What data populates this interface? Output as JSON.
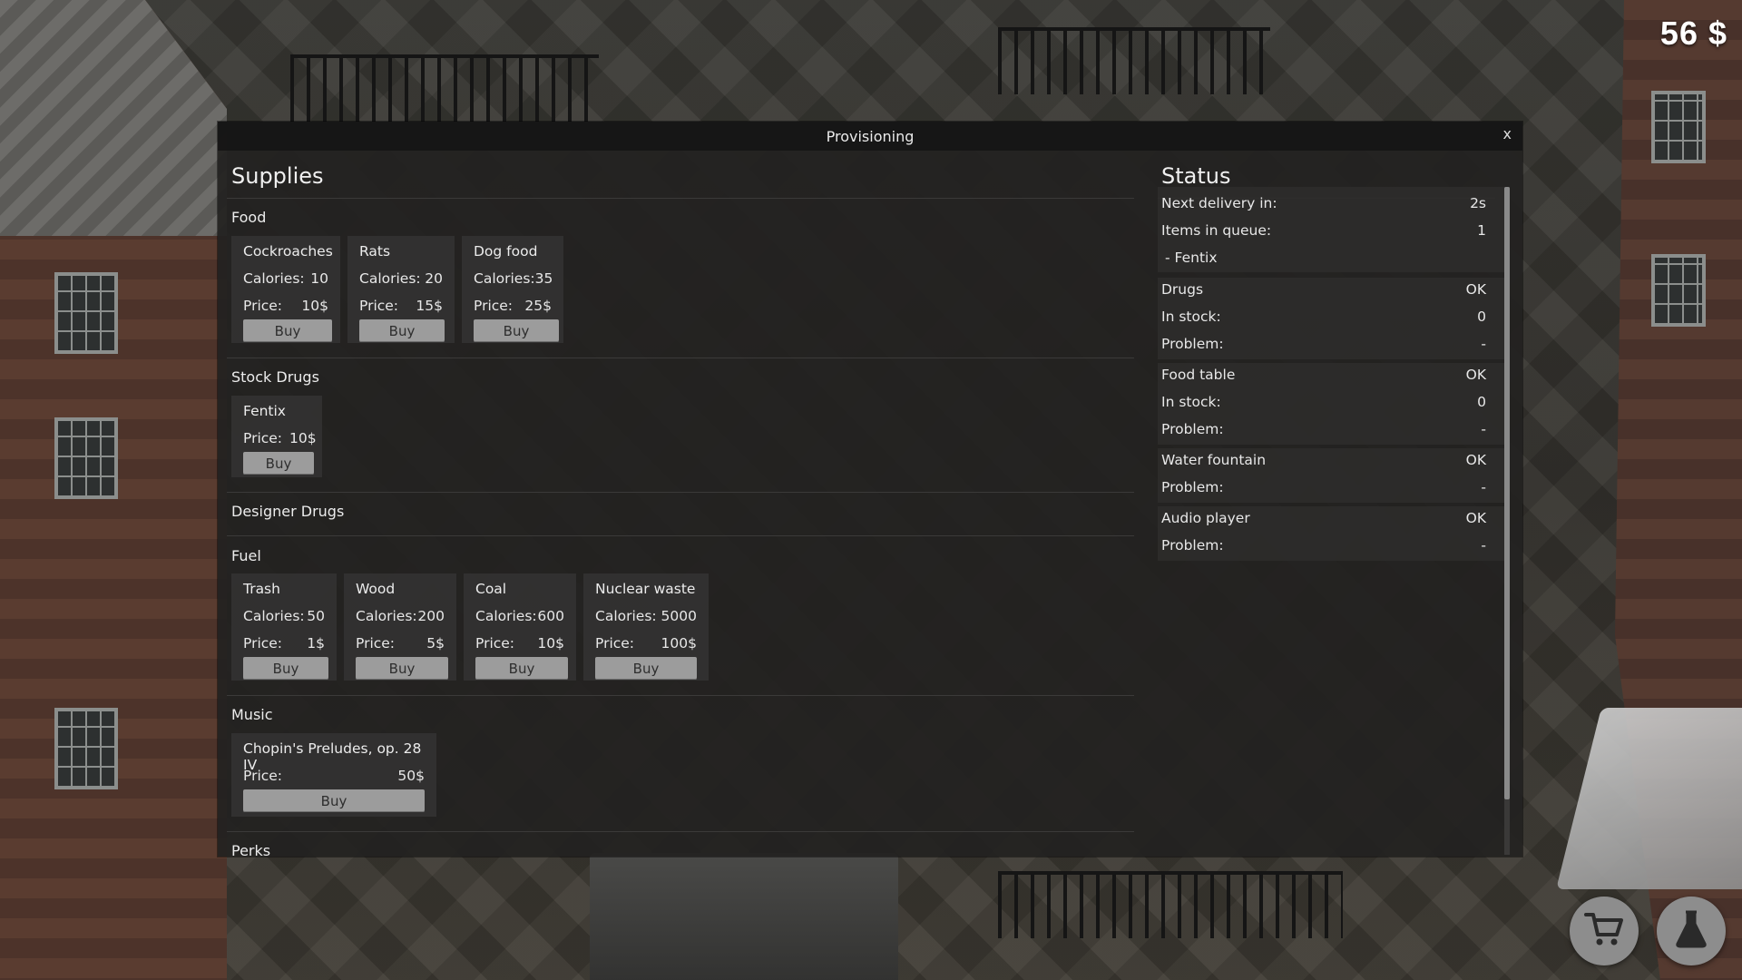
{
  "hud": {
    "money": "56 $"
  },
  "window": {
    "title": "Provisioning",
    "close": "x"
  },
  "supplies": {
    "heading": "Supplies",
    "categories": [
      {
        "name": "Food",
        "items": [
          {
            "name": "Cockroaches",
            "calories_label": "Calories:",
            "calories": "10",
            "price_label": "Price:",
            "price": "10$",
            "buy": "Buy"
          },
          {
            "name": "Rats",
            "calories_label": "Calories:",
            "calories": "20",
            "price_label": "Price:",
            "price": "15$",
            "buy": "Buy"
          },
          {
            "name": "Dog food",
            "calories_label": "Calories:",
            "calories": "35",
            "price_label": "Price:",
            "price": "25$",
            "buy": "Buy"
          }
        ]
      },
      {
        "name": "Stock Drugs",
        "items": [
          {
            "name": "Fentix",
            "price_label": "Price:",
            "price": "10$",
            "buy": "Buy"
          }
        ]
      },
      {
        "name": "Designer Drugs",
        "items": []
      },
      {
        "name": "Fuel",
        "items": [
          {
            "name": "Trash",
            "calories_label": "Calories:",
            "calories": "50",
            "price_label": "Price:",
            "price": "1$",
            "buy": "Buy"
          },
          {
            "name": "Wood",
            "calories_label": "Calories:",
            "calories": "200",
            "price_label": "Price:",
            "price": "5$",
            "buy": "Buy"
          },
          {
            "name": "Coal",
            "calories_label": "Calories:",
            "calories": "600",
            "price_label": "Price:",
            "price": "10$",
            "buy": "Buy"
          },
          {
            "name": "Nuclear waste",
            "calories_label": "Calories:",
            "calories": "5000",
            "price_label": "Price:",
            "price": "100$",
            "buy": "Buy"
          }
        ]
      },
      {
        "name": "Music",
        "items": [
          {
            "name": "Chopin's Preludes, op. 28 IV",
            "price_label": "Price:",
            "price": "50$",
            "buy": "Buy"
          }
        ]
      },
      {
        "name": "Perks",
        "items": []
      }
    ]
  },
  "status": {
    "heading": "Status",
    "delivery": {
      "next_label": "Next delivery in:",
      "next_value": "2s",
      "queue_label": "Items in queue:",
      "queue_value": "1",
      "queue_item": "- Fentix"
    },
    "drugs": {
      "label": "Drugs",
      "state": "OK",
      "stock_label": "In stock:",
      "stock": "0",
      "problem_label": "Problem:",
      "problem": "-"
    },
    "food_table": {
      "label": "Food table",
      "state": "OK",
      "stock_label": "In stock:",
      "stock": "0",
      "problem_label": "Problem:",
      "problem": "-"
    },
    "water_fountain": {
      "label": "Water fountain",
      "state": "OK",
      "problem_label": "Problem:",
      "problem": "-"
    },
    "audio_player": {
      "label": "Audio player",
      "state": "OK",
      "problem_label": "Problem:",
      "problem": "-"
    }
  },
  "icons": {
    "shop": "cart-icon",
    "research": "flask-icon"
  }
}
